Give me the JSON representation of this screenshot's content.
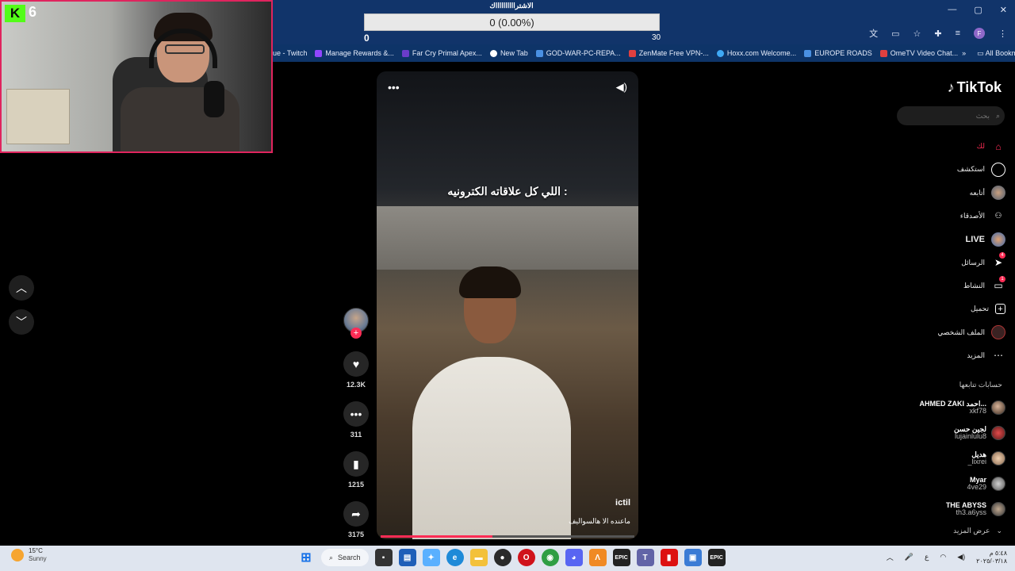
{
  "browser": {
    "window_controls": [
      "—",
      "▢",
      "✕"
    ],
    "bookmarks": [
      {
        "label": "ue - Twitch",
        "color": "#9146ff"
      },
      {
        "label": "Manage Rewards &...",
        "color": "#9146ff"
      },
      {
        "label": "Far Cry Primal Apex...",
        "color": "#6b3cc9"
      },
      {
        "label": "New Tab",
        "color": "#ffffff"
      },
      {
        "label": "GOD-WAR-PC-REPA...",
        "color": "#4a90e2"
      },
      {
        "label": "ZenMate Free VPN-...",
        "color": "#e04040"
      },
      {
        "label": "Hoxx.com Welcome...",
        "color": "#3fa9f5"
      },
      {
        "label": "EUROPE ROADS",
        "color": "#4a90e2"
      },
      {
        "label": "OmeTV Video Chat...",
        "color": "#e04040"
      }
    ],
    "all_bookmarks": "All Bookmarks",
    "profile_initial": "F"
  },
  "goal": {
    "title": "الاشترااااااااااك",
    "bar_text": "0 (0.00%)",
    "progress_percent": 0,
    "min": "0",
    "max": "30"
  },
  "webcam": {
    "badge_letter": "K",
    "badge_count": "6"
  },
  "video": {
    "caption": "اللي كل علاقاته الكترونيه :",
    "author": "ictil",
    "description": "ماعنده الا هالسواليف",
    "progress_percent": 44
  },
  "actions": {
    "likes": "12.3K",
    "comments": "311",
    "saves": "1215",
    "shares": "3175"
  },
  "sidebar": {
    "logo": "TikTok",
    "search_placeholder": "بحث",
    "items": [
      {
        "label": "لك",
        "icon": "home-icon",
        "glyph": "⌂",
        "active": true
      },
      {
        "label": "استكشف",
        "icon": "compass-icon",
        "glyph": "◎"
      },
      {
        "label": "أتابعه",
        "icon": "following-avatar-icon",
        "glyph": "●"
      },
      {
        "label": "الأصدقاء",
        "icon": "friends-icon",
        "glyph": "👥"
      },
      {
        "label": "LIVE",
        "icon": "live-avatar-icon",
        "glyph": "●",
        "live": true
      },
      {
        "label": "الرسائل",
        "icon": "send-icon",
        "glyph": "➤",
        "badge": "4"
      },
      {
        "label": "النشاط",
        "icon": "activity-icon",
        "glyph": "▭",
        "badge": "1"
      },
      {
        "label": "تحميل",
        "icon": "upload-icon",
        "glyph": "+"
      },
      {
        "label": "الملف الشخصي",
        "icon": "profile-icon",
        "glyph": "●"
      },
      {
        "label": "المزيد",
        "icon": "more-icon",
        "glyph": "⋯"
      }
    ],
    "following_title": "حسابات تتابعها",
    "following": [
      {
        "name": "AHMED ZAKI احمد...",
        "handle": "xkf78"
      },
      {
        "name": "لجين حسن",
        "handle": "lujainlulu8"
      },
      {
        "name": "هديل",
        "handle": "_lixrei"
      },
      {
        "name": "Myar",
        "handle": "4ve29"
      },
      {
        "name": "THE ABYSS",
        "handle": "th3.a6yss"
      }
    ],
    "see_more": "عرض المزيد"
  },
  "taskbar": {
    "temp": "15°C",
    "condition": "Sunny",
    "search_label": "Search",
    "lang": "ع",
    "time": "٥:٤٨ م",
    "date": "٢٠٢٥/٠٣/١٨"
  },
  "colors": {
    "accent": "#fe2c55",
    "chrome": "#11346a",
    "taskbar": "#dfe5ef"
  }
}
